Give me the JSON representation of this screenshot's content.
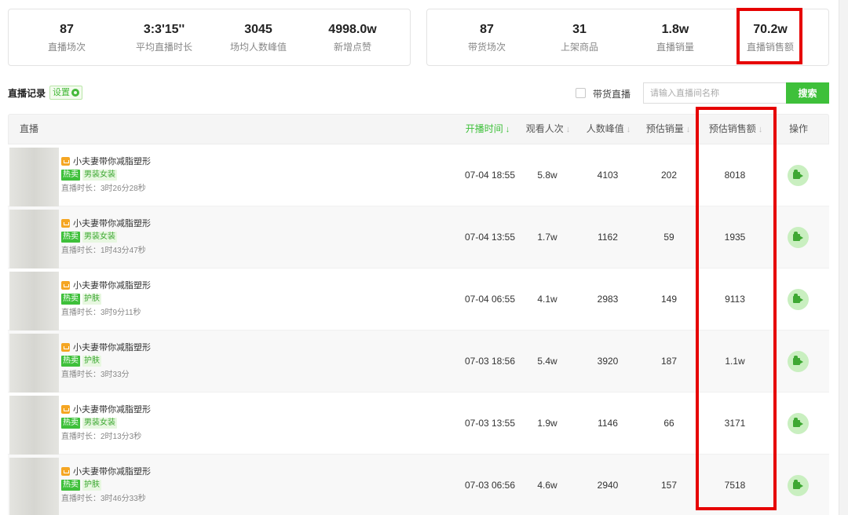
{
  "summary_left": [
    {
      "value": "87",
      "label": "直播场次"
    },
    {
      "value": "3:3'15''",
      "label": "平均直播时长"
    },
    {
      "value": "3045",
      "label": "场均人数峰值"
    },
    {
      "value": "4998.0w",
      "label": "新增点赞"
    }
  ],
  "summary_right": [
    {
      "value": "87",
      "label": "带货场次"
    },
    {
      "value": "31",
      "label": "上架商品"
    },
    {
      "value": "1.8w",
      "label": "直播销量"
    },
    {
      "value": "70.2w",
      "label": "直播销售额"
    }
  ],
  "toolbar": {
    "title": "直播记录",
    "settings_label": "设置",
    "checkbox_label": "带货直播",
    "search_placeholder": "请输入直播间名称",
    "search_button": "搜索"
  },
  "table": {
    "headers": {
      "live": "直播",
      "start_time": "开播时间",
      "views": "观看人次",
      "peak": "人数峰值",
      "est_sales": "预估销量",
      "est_revenue": "预估销售额",
      "ops": "操作"
    },
    "sort_arrow": "↓",
    "rows": [
      {
        "name": "小夫妻带你减脂塑形",
        "hot": "热卖",
        "category": "男装女装",
        "duration": "直播时长：3时26分28秒",
        "start_time": "07-04 18:55",
        "views": "5.8w",
        "peak": "4103",
        "est_sales": "202",
        "est_revenue": "8018"
      },
      {
        "name": "小夫妻带你减脂塑形",
        "hot": "热卖",
        "category": "男装女装",
        "duration": "直播时长：1时43分47秒",
        "start_time": "07-04 13:55",
        "views": "1.7w",
        "peak": "1162",
        "est_sales": "59",
        "est_revenue": "1935"
      },
      {
        "name": "小夫妻带你减脂塑形",
        "hot": "热卖",
        "category": "护肤",
        "duration": "直播时长：3时9分11秒",
        "start_time": "07-04 06:55",
        "views": "4.1w",
        "peak": "2983",
        "est_sales": "149",
        "est_revenue": "9113"
      },
      {
        "name": "小夫妻带你减脂塑形",
        "hot": "热卖",
        "category": "护肤",
        "duration": "直播时长：3时33分",
        "start_time": "07-03 18:56",
        "views": "5.4w",
        "peak": "3920",
        "est_sales": "187",
        "est_revenue": "1.1w"
      },
      {
        "name": "小夫妻带你减脂塑形",
        "hot": "热卖",
        "category": "男装女装",
        "duration": "直播时长：2时13分3秒",
        "start_time": "07-03 13:55",
        "views": "1.9w",
        "peak": "1146",
        "est_sales": "66",
        "est_revenue": "3171"
      },
      {
        "name": "小夫妻带你减脂塑形",
        "hot": "热卖",
        "category": "护肤",
        "duration": "直播时长：3时46分33秒",
        "start_time": "07-03 06:56",
        "views": "4.6w",
        "peak": "2940",
        "est_sales": "157",
        "est_revenue": "7518"
      }
    ]
  },
  "icons": {
    "settings": "gear-icon",
    "shop": "shop-icon",
    "operation": "video-camera-icon"
  },
  "colors": {
    "accent": "#3ec03a",
    "highlight": "#e60000",
    "shop_badge": "#f5a623"
  }
}
